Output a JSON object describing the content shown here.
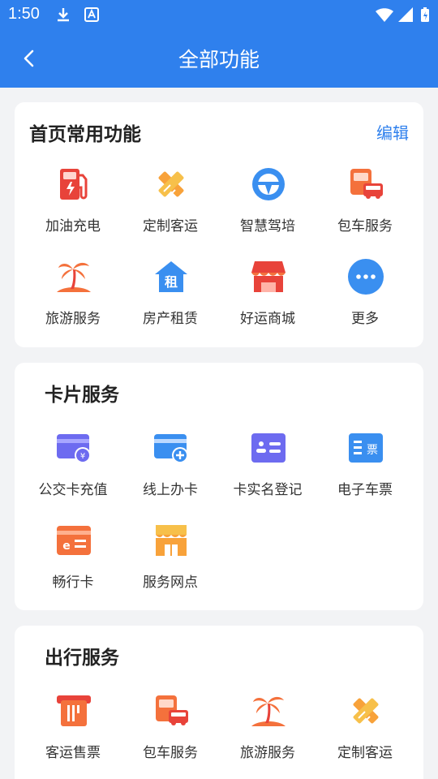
{
  "status": {
    "time": "1:50"
  },
  "header": {
    "title": "全部功能"
  },
  "common": {
    "title": "首页常用功能",
    "edit_label": "编辑",
    "items": [
      "加油充电",
      "定制客运",
      "智慧驾培",
      "包车服务",
      "旅游服务",
      "房产租赁",
      "好运商城",
      "更多"
    ]
  },
  "card_services": {
    "title": "卡片服务",
    "items": [
      "公交卡充值",
      "线上办卡",
      "卡实名登记",
      "电子车票",
      "畅行卡",
      "服务网点"
    ]
  },
  "travel": {
    "title": "出行服务",
    "items": [
      "客运售票",
      "包车服务",
      "旅游服务",
      "定制客运"
    ]
  },
  "colors": {
    "primary": "#2f80ed",
    "orange": "#f4713c",
    "red": "#e8433a",
    "blue": "#3a8ff0",
    "purple": "#6d6bf0"
  }
}
